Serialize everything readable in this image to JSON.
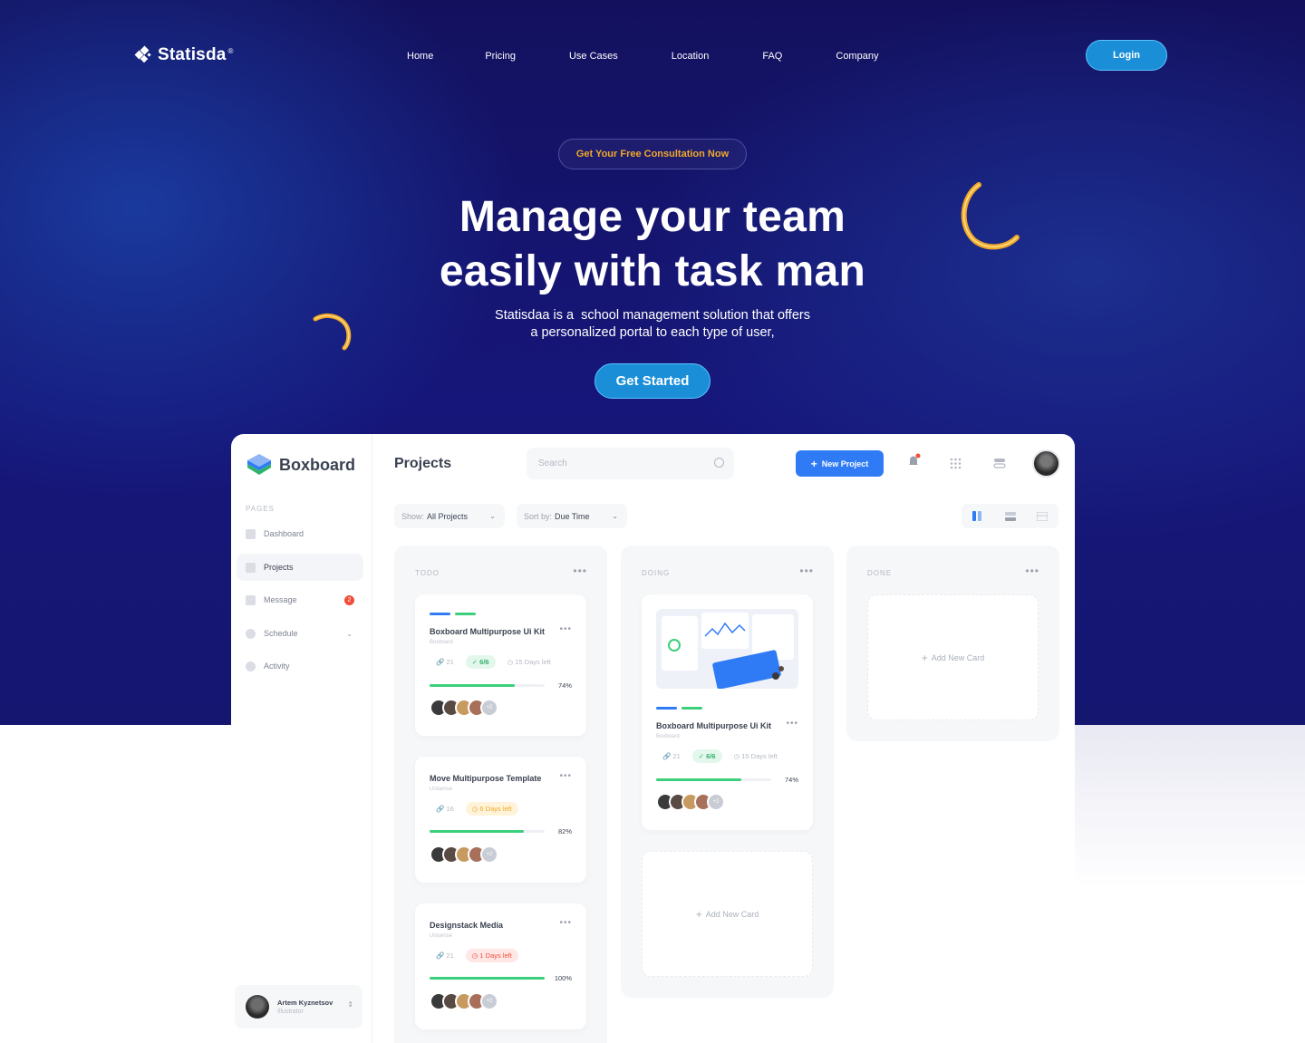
{
  "site": {
    "brand": "Statisda",
    "brand_mark": "®",
    "nav": [
      "Home",
      "Pricing",
      "Use Cases",
      "Location",
      "FAQ",
      "Company"
    ],
    "login": "Login"
  },
  "hero": {
    "pill": "Get Your Free Consultation Now",
    "headline_line1": "Manage your team",
    "headline_line2": "easily with task man",
    "sub_line1": "Statisdaa is a  school management solution that offers",
    "sub_line2": "a personalized portal to each type of user,",
    "cta": "Get Started"
  },
  "colors": {
    "hero_bg": "#13115e",
    "accent_blue": "#1a8fd8",
    "gold": "#f0a92a",
    "primary": "#2f7bf5",
    "green": "#3ccf7b"
  },
  "dashboard": {
    "brand": "Boxboard",
    "pages_label": "PAGES",
    "sidebar": [
      {
        "label": "Dashboard",
        "icon": "grid-icon"
      },
      {
        "label": "Projects",
        "icon": "document-icon"
      },
      {
        "label": "Message",
        "icon": "message-icon",
        "badge": "2"
      },
      {
        "label": "Schedule",
        "icon": "clock-icon"
      },
      {
        "label": "Activity",
        "icon": "activity-icon"
      }
    ],
    "user": {
      "name": "Artem Kyznetsov",
      "role": "Illustrator"
    },
    "title": "Projects",
    "search_placeholder": "Search",
    "new_project": "New Project",
    "filters": {
      "show_label": "Show:",
      "show_value": "All Projects",
      "sort_label": "Sort by:",
      "sort_value": "Due Time"
    },
    "columns": [
      {
        "title": "TODO"
      },
      {
        "title": "DOING"
      },
      {
        "title": "DONE"
      }
    ],
    "add_card": "Add New Card",
    "cards": {
      "todo1": {
        "title": "Boxboard Multipurpose Ui Kit",
        "sub": "Boxboard",
        "links": "21",
        "tasks": "6/6",
        "due": "15 Days left",
        "progress": 0.74,
        "pct": "74%",
        "more": "+2"
      },
      "todo2": {
        "title": "Move Multipurpose Template",
        "sub": "Unisense",
        "links": "16",
        "due": "6 Days left",
        "progress": 0.82,
        "pct": "82%",
        "more": "+2"
      },
      "todo3": {
        "title": "Designstack Media",
        "sub": "Unisense",
        "links": "21",
        "due": "1 Days left",
        "progress": 1.0,
        "pct": "100%",
        "more": "+2"
      },
      "doing1": {
        "title": "Boxboard Multipurpose Ui Kit",
        "sub": "Boxboard",
        "links": "21",
        "tasks": "6/6",
        "due": "15 Days left",
        "progress": 0.74,
        "pct": "74%",
        "more": "+2"
      }
    }
  }
}
